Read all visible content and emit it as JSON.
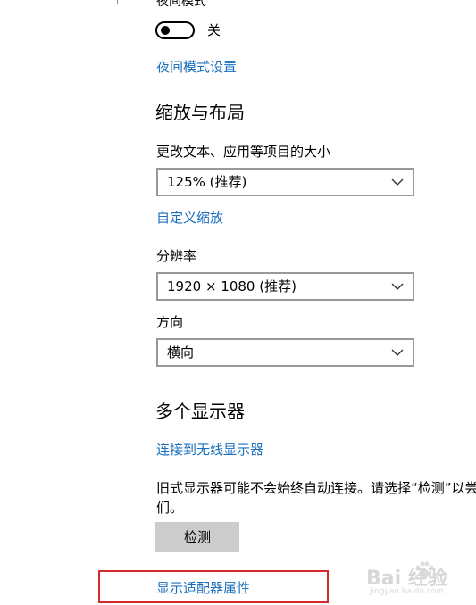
{
  "display": {
    "night_mode": {
      "label": "夜间模式",
      "toggle_state": "关",
      "settings_link": "夜间模式设置"
    },
    "scale_layout": {
      "title": "缩放与布局",
      "size_label": "更改文本、应用等项目的大小",
      "size_value": "125% (推荐)",
      "custom_scale_link": "自定义缩放",
      "resolution_label": "分辨率",
      "resolution_value": "1920 × 1080 (推荐)",
      "orientation_label": "方向",
      "orientation_value": "横向"
    },
    "multi_display": {
      "title": "多个显示器",
      "wireless_link": "连接到无线显示器",
      "description_line1": "旧式显示器可能不会始终自动连接。请选择“检测”以尝",
      "description_line2": "们。",
      "detect_button": "检测",
      "adapter_link": "显示适配器属性"
    }
  },
  "watermark": {
    "logo": "Bai 经验",
    "url": "jingyan.baidu.com"
  },
  "colors": {
    "link": "#1a6fbd",
    "button_bg": "#cccccc",
    "highlight_border": "#d42a2a",
    "select_border": "#999999"
  },
  "icons": {
    "dropdown": "chevron-down-icon",
    "toggle": "toggle-switch"
  }
}
